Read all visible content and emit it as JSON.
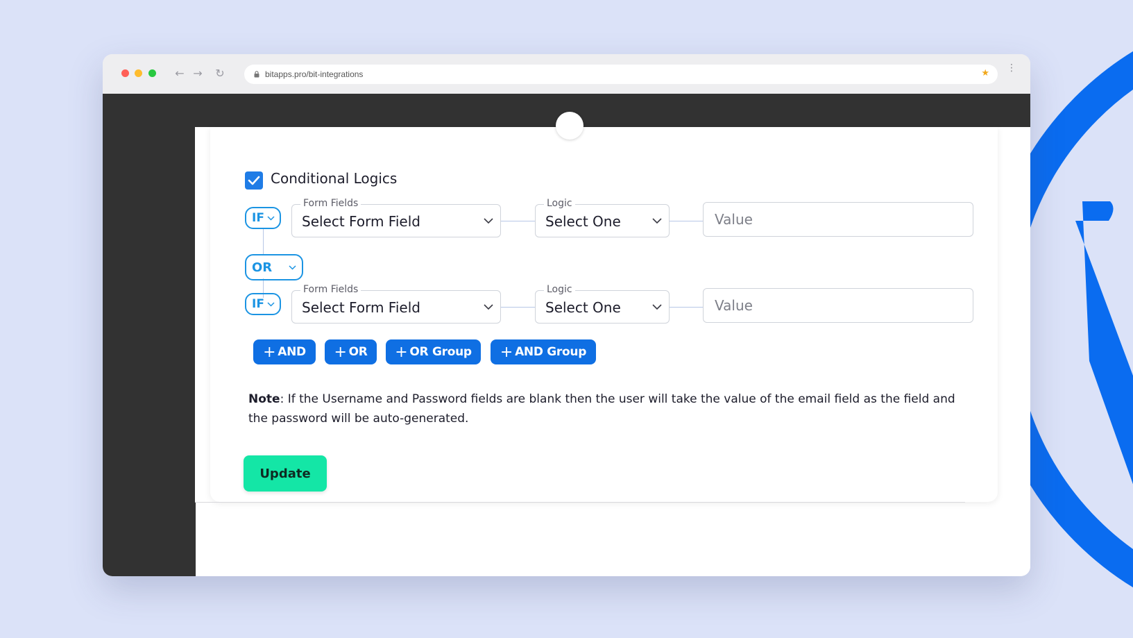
{
  "browser": {
    "url": "bitapps.pro/bit-integrations"
  },
  "section": {
    "title": "Conditional Logics",
    "checked": true
  },
  "rows": [
    {
      "condition": "IF",
      "form_field_label": "Form Fields",
      "form_field_value": "Select Form Field",
      "logic_label": "Logic",
      "logic_value": "Select One",
      "value_placeholder": "Value"
    },
    {
      "condition": "IF",
      "form_field_label": "Form Fields",
      "form_field_value": "Select Form Field",
      "logic_label": "Logic",
      "logic_value": "Select One",
      "value_placeholder": "Value"
    }
  ],
  "connector_operator": "OR",
  "actions": {
    "add_and": "AND",
    "add_or": "OR",
    "add_or_group": "OR Group",
    "add_and_group": "AND Group"
  },
  "note": {
    "label": "Note",
    "text": ": If the Username and Password fields are blank then the user will take the value of the email field as the field and the password will be auto-generated."
  },
  "update_label": "Update",
  "colors": {
    "primary": "#0f6fe3",
    "outline": "#1b94e3",
    "update": "#14e6a6",
    "wordpress": "#0a6cf0"
  }
}
